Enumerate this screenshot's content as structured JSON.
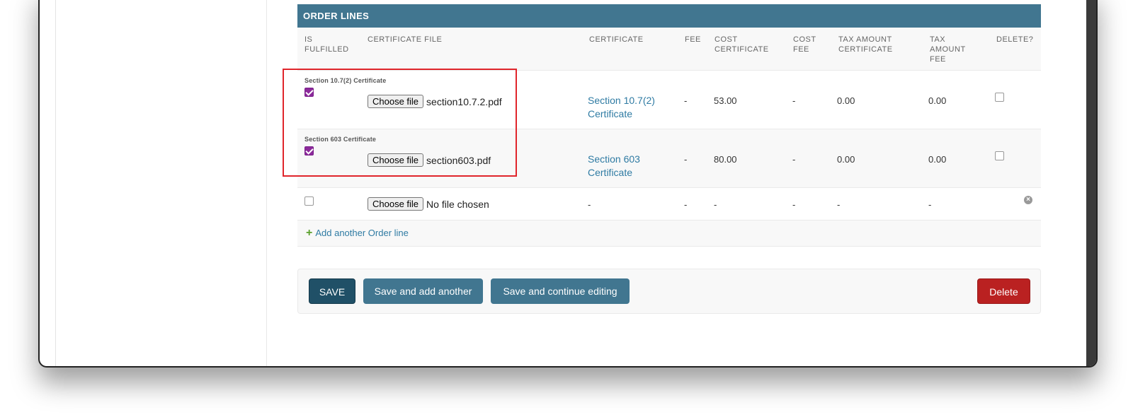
{
  "inline_group": {
    "title": "ORDER LINES",
    "columns": [
      "IS FULFILLED",
      "CERTIFICATE FILE",
      "CERTIFICATE",
      "FEE",
      "COST CERTIFICATE",
      "COST FEE",
      "TAX AMOUNT CERTIFICATE",
      "TAX AMOUNT FEE",
      "DELETE?"
    ],
    "rows": [
      {
        "label": "Section 10.7(2) Certificate",
        "is_fulfilled": true,
        "file_button": "Choose file",
        "file_name": "section10.7.2.pdf",
        "certificate": "Section 10.7(2) Certificate",
        "fee": "-",
        "cost_certificate": "53.00",
        "cost_fee": "-",
        "tax_amount_certificate": "0.00",
        "tax_amount_fee": "0.00",
        "delete": false
      },
      {
        "label": "Section 603 Certificate",
        "is_fulfilled": true,
        "file_button": "Choose file",
        "file_name": "section603.pdf",
        "certificate": "Section 603 Certificate",
        "fee": "-",
        "cost_certificate": "80.00",
        "cost_fee": "-",
        "tax_amount_certificate": "0.00",
        "tax_amount_fee": "0.00",
        "delete": false
      }
    ],
    "empty_row": {
      "is_fulfilled": false,
      "file_button": "Choose file",
      "file_name": "No file chosen",
      "certificate": "-",
      "fee": "-",
      "cost_certificate": "-",
      "cost_fee": "-",
      "tax_amount_certificate": "-",
      "tax_amount_fee": "-",
      "remove_icon": "remove-circle-icon"
    },
    "add_link": "Add another Order line",
    "add_icon": "plus-icon"
  },
  "submit_row": {
    "save": "SAVE",
    "save_add_another": "Save and add another",
    "save_continue": "Save and continue editing",
    "delete": "Delete"
  },
  "colors": {
    "header_bg": "#417690",
    "save_bg": "#205067",
    "delete_bg": "#ba2121",
    "highlight": "#e0252b",
    "checkbox_checked": "#8c2a9b"
  }
}
